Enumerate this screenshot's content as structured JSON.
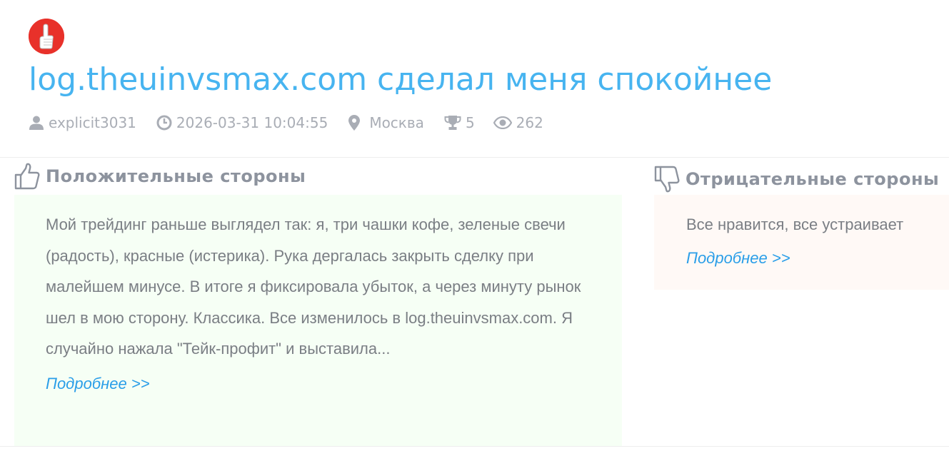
{
  "header": {
    "logo_icon": "thumb-up-finger-icon",
    "title": "log.theuinvsmax.com сделал меня спокойнее",
    "title_color": "#47b4f0"
  },
  "meta": {
    "author": "explicit3031",
    "datetime": "2026-03-31 10:04:55",
    "location": "Москва",
    "trophies": "5",
    "views": "262"
  },
  "pros": {
    "title": "Положительные стороны",
    "text": "Мой трейдинг раньше выглядел так: я, три чашки кофе, зеленые свечи (радость), красные (истерика). Рука дергалась закрыть сделку при малейшем минусе. В итоге я фиксировала убыток, а через минуту рынок шел в мою сторону. Классика. Все изменилось в log.theuinvsmax.com. Я случайно нажала \"Тейк-профит\" и выставила...",
    "more_link": "Подробнее >>",
    "background": "#f6fff5"
  },
  "cons": {
    "title": "Отрицательные стороны",
    "text": "Все нравится, все устраивает",
    "more_link": "Подробнее >>",
    "background": "#fff9f6"
  },
  "colors": {
    "accent": "#47b4f0",
    "link": "#2a9ee8",
    "logo_red": "#e8312a",
    "meta_gray": "#a9adb5"
  }
}
